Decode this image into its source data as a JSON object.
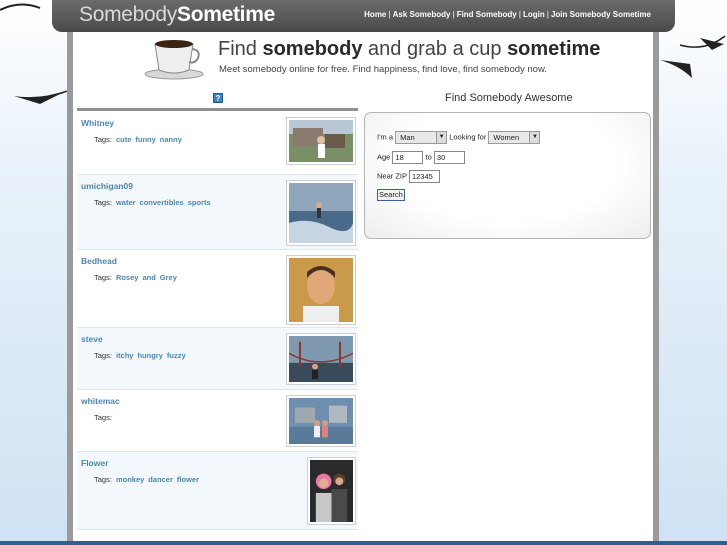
{
  "header": {
    "logo_light": "Somebody",
    "logo_bold": "Sometime",
    "nav": [
      {
        "label": "Home"
      },
      {
        "label": "Ask Somebody"
      },
      {
        "label": "Find Somebody"
      },
      {
        "label": "Login"
      },
      {
        "label": "Join Somebody Sometime"
      }
    ],
    "separator": "|"
  },
  "banner": {
    "tagline_1": "Find ",
    "tagline_2": "somebody",
    "tagline_3": " and grab a cup ",
    "tagline_4": "sometime",
    "subline": "Meet somebody online for free. Find happiness, find love, find somebody now."
  },
  "help_icon": "?",
  "profiles": [
    {
      "name": "Whitney",
      "tags_label": "Tags:",
      "tags": [
        "cute",
        "funny",
        "nanny"
      ]
    },
    {
      "name": "umichigan09",
      "tags_label": "Tags:",
      "tags": [
        "water",
        "convertibles",
        "sports"
      ]
    },
    {
      "name": "Bedhead",
      "tags_label": "Tags:",
      "tags": [
        "Rosey",
        "and",
        "Grey"
      ]
    },
    {
      "name": "steve",
      "tags_label": "Tags:",
      "tags": [
        "itchy",
        "hungry",
        "fuzzy"
      ]
    },
    {
      "name": "whitemac",
      "tags_label": "Tags:",
      "tags": []
    },
    {
      "name": "Flower",
      "tags_label": "Tags:",
      "tags": [
        "monkey",
        "dancer",
        "flower"
      ]
    }
  ],
  "search": {
    "title": "Find Somebody Awesome",
    "im_a_label": "I'm a",
    "im_a_value": "Man",
    "looking_for_label": "Looking for",
    "looking_for_value": "Women",
    "age_label": "Age",
    "age_min": "18",
    "to_label": "to",
    "age_max": "30",
    "zip_label": "Near ZIP",
    "zip_value": "12345",
    "button": "Search"
  },
  "colors": {
    "header_bg": "#555555",
    "link_blue": "#4a86b8",
    "help_icon_blue": "#3b7fc4"
  },
  "icons": [
    "coffee-cup-icon",
    "help-icon",
    "dropdown-arrow-icon",
    "swirl-decoration-icon"
  ]
}
